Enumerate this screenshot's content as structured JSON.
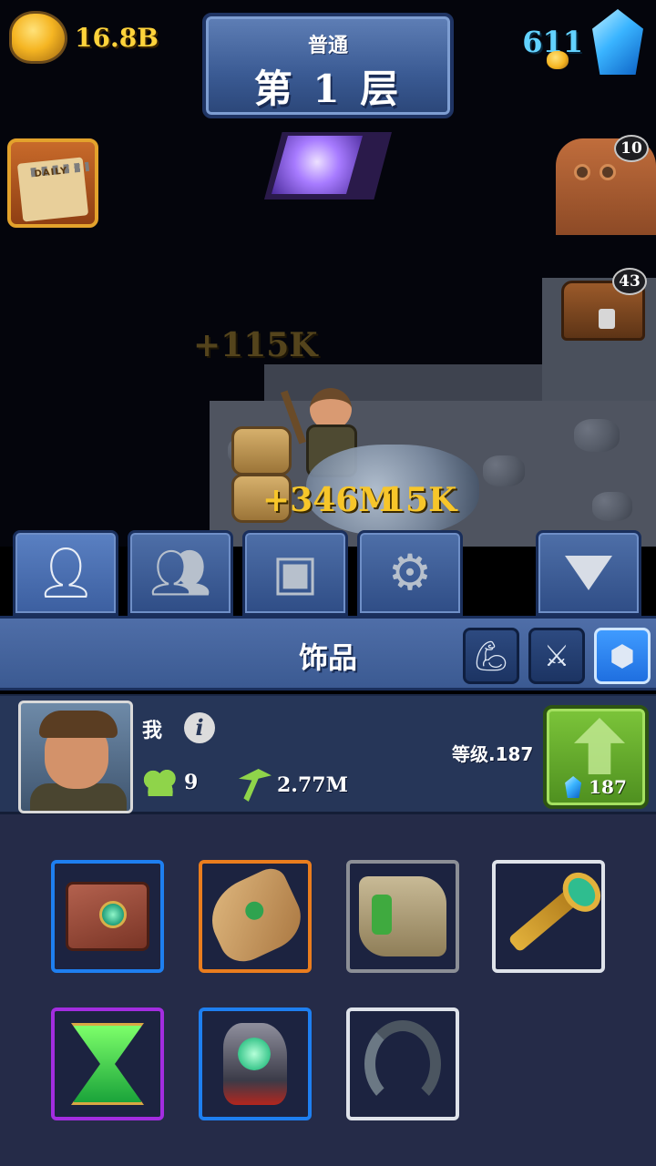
{
  "hud": {
    "gold_amount": "16.8B",
    "gem_amount": "611"
  },
  "level": {
    "mode": "普通",
    "name": "第 1 层"
  },
  "side_buttons": {
    "daily_label": "DAILY",
    "robot_badge": "10",
    "chest_badge": "43"
  },
  "floating_rewards": {
    "faded": "+115K",
    "active": "+346M",
    "active_overlap": "15K"
  },
  "tabs": [
    {
      "name": "character",
      "icon": "person-pickaxe-icon"
    },
    {
      "name": "workers",
      "icon": "group-icon"
    },
    {
      "name": "chest",
      "icon": "chest-icon"
    },
    {
      "name": "settings",
      "icon": "gear-icon"
    }
  ],
  "collapse_icon": "chevron-down-icon",
  "section": {
    "title": "饰品",
    "filters": [
      {
        "icon": "strength-icon",
        "selected": false
      },
      {
        "icon": "crossed-tools-icon",
        "selected": false
      },
      {
        "icon": "accessory-icon",
        "selected": true
      }
    ]
  },
  "player": {
    "name": "我",
    "info_icon": "i",
    "workers": "9",
    "mining_power": "2.77M",
    "level_label": "等级.187",
    "upgrade_cost": "187"
  },
  "inventory": {
    "items": [
      {
        "name": "enchanted-book",
        "rarity": "blue"
      },
      {
        "name": "ancient-scroll",
        "rarity": "orange"
      },
      {
        "name": "treasure-map",
        "rarity": "gray"
      },
      {
        "name": "golden-key",
        "rarity": "white"
      },
      {
        "name": "emerald-hourglass",
        "rarity": "purple"
      },
      {
        "name": "rune-stone",
        "rarity": "blue"
      },
      {
        "name": "worm-tail",
        "rarity": "white"
      }
    ]
  },
  "colors": {
    "gold_text": "#ffd33b",
    "gem_text": "#62d2ff",
    "panel_blue": "#3b5a92",
    "upgrade_green": "#7cc53a",
    "rarity_blue": "#1e7ff0",
    "rarity_orange": "#ea7d1e",
    "rarity_purple": "#a32de0"
  }
}
